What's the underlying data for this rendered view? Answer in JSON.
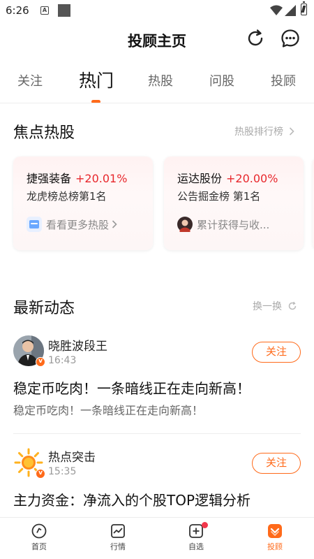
{
  "status_bar": {
    "time": "6:26",
    "a_icon": "A"
  },
  "header": {
    "title": "投顾主页",
    "icons": [
      "refresh-icon",
      "message-icon"
    ]
  },
  "tabs": [
    {
      "label": "关注",
      "active": false
    },
    {
      "label": "热门",
      "active": true
    },
    {
      "label": "热股",
      "active": false
    },
    {
      "label": "问股",
      "active": false
    },
    {
      "label": "投顾",
      "active": false
    }
  ],
  "hot_stocks": {
    "title": "焦点热股",
    "link": "热股排行榜",
    "cards": [
      {
        "name": "捷强装备",
        "change": "+20.01%",
        "rank": "龙虎榜总榜第1名",
        "footer": "看看更多热股"
      },
      {
        "name": "运达股份",
        "change": "+20.00%",
        "rank": "公告掘金榜 第1名",
        "footer": "累计获得与收..."
      }
    ]
  },
  "feed": {
    "title": "最新动态",
    "refresh_label": "换一换",
    "posts": [
      {
        "author": "晓胜波段王",
        "time": "16:43",
        "follow": "关注",
        "title": "稳定币吃肉！一条暗线正在走向新高！",
        "subtitle": "稳定币吃肉！一条暗线正在走向新高！"
      },
      {
        "author": "热点突击",
        "time": "15:35",
        "follow": "关注",
        "title": "主力资金：净流入的个股TOP逻辑分析",
        "subtitle": ""
      }
    ]
  },
  "bottom_nav": [
    {
      "label": "首页",
      "icon": "home-icon",
      "active": false
    },
    {
      "label": "行情",
      "icon": "market-chart-icon",
      "active": false
    },
    {
      "label": "自选",
      "icon": "add-watchlist-icon",
      "active": false,
      "badge": true
    },
    {
      "label": "投顾",
      "icon": "advisor-icon",
      "active": true
    }
  ],
  "colors": {
    "accent": "#ff6a1a",
    "gain": "#e8272c",
    "badge": "#f2374b"
  }
}
